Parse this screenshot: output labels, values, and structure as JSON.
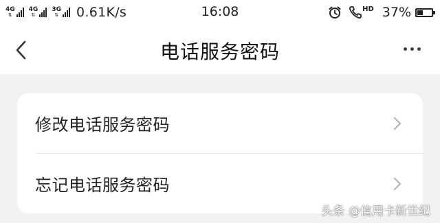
{
  "status_bar": {
    "signal_1_label": "4G",
    "signal_2_label": "4G",
    "signal_3_label": "3G",
    "network_speed": "0.61K/s",
    "time": "16:08",
    "alarm_icon": "alarm-clock-icon",
    "call_icon": "hd-call-icon",
    "hd_label": "HD",
    "battery_percent": "37%",
    "battery_level": 0.37
  },
  "nav": {
    "back_icon": "chevron-left-icon",
    "title": "电话服务密码",
    "more_icon": "more-dots-icon"
  },
  "menu": {
    "items": [
      {
        "label": "修改电话服务密码",
        "icon": "chevron-right-icon"
      },
      {
        "label": "忘记电话服务密码",
        "icon": "chevron-right-icon"
      }
    ]
  },
  "watermark": "头条 @信用卡新世纪",
  "colors": {
    "background": "#f2f2f2",
    "card": "#ffffff",
    "text": "#222222",
    "chevron": "#b5b5b5"
  }
}
